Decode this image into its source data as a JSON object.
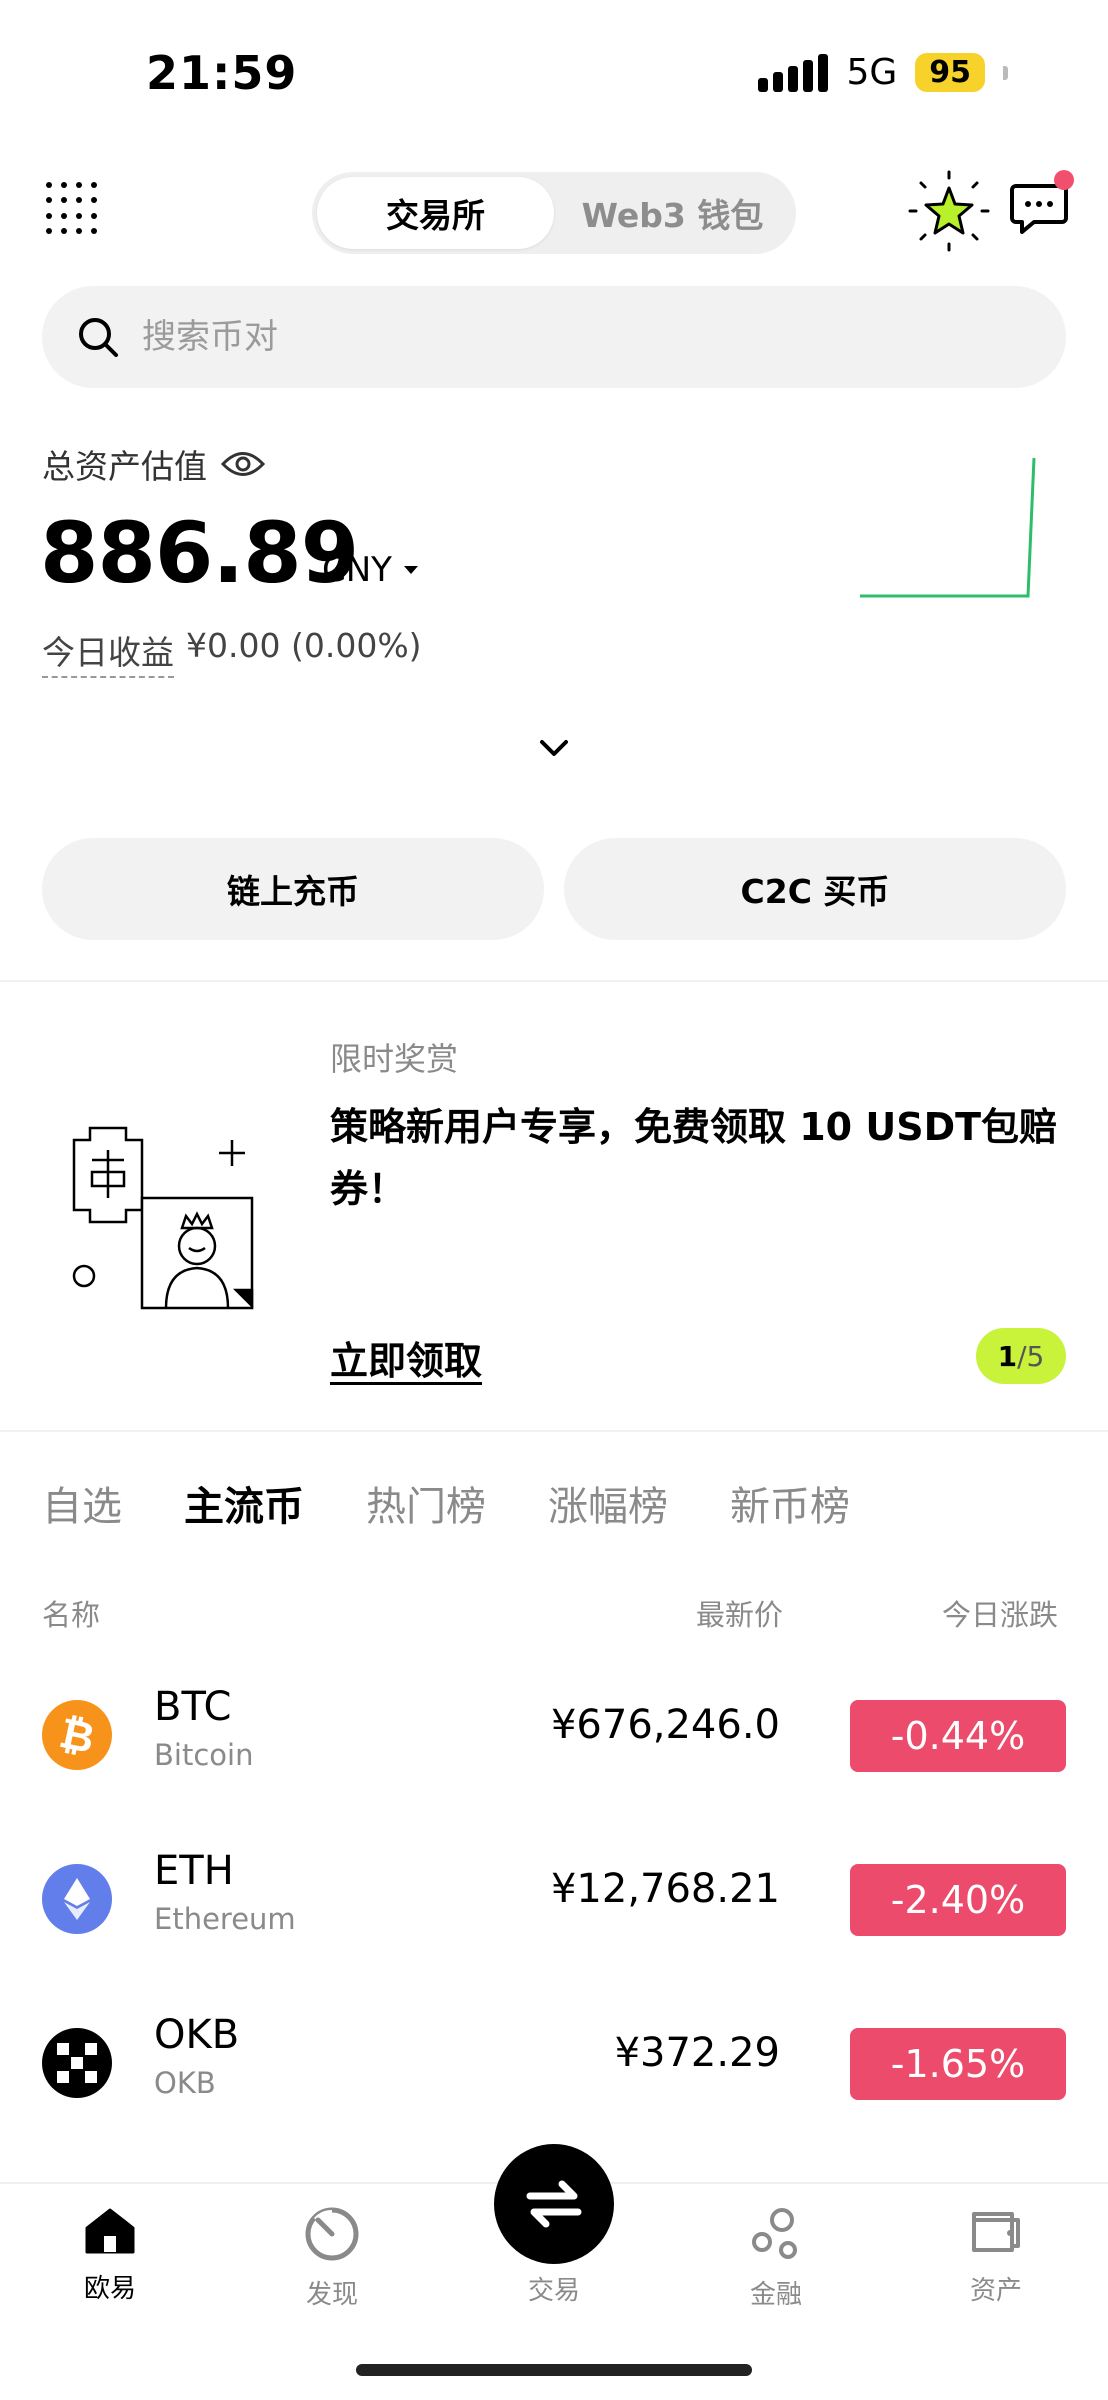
{
  "status_bar": {
    "time": "21:59",
    "network": "5G",
    "battery": "95"
  },
  "header": {
    "tabs": [
      {
        "label": "交易所",
        "active": true
      },
      {
        "label": "Web3 钱包",
        "active": false
      }
    ]
  },
  "search": {
    "placeholder": "搜索币对"
  },
  "assets": {
    "label": "总资产估值",
    "value": "886.89",
    "currency": "CNY",
    "pnl_label": "今日收益",
    "pnl_value": "¥0.00 (0.00%)"
  },
  "actions": {
    "onchain_deposit": "链上充币",
    "c2c_buy": "C2C 买币"
  },
  "promo": {
    "tag": "限时奖赏",
    "title": "策略新用户专享，免费领取 10 USDT包赔券！",
    "cta": "立即领取",
    "page_current": "1",
    "page_total": "/5"
  },
  "market_tabs": [
    {
      "label": "自选",
      "active": false
    },
    {
      "label": "主流币",
      "active": true
    },
    {
      "label": "热门榜",
      "active": false
    },
    {
      "label": "涨幅榜",
      "active": false
    },
    {
      "label": "新币榜",
      "active": false
    }
  ],
  "columns": {
    "name": "名称",
    "price": "最新价",
    "change": "今日涨跌"
  },
  "coins": [
    {
      "symbol": "BTC",
      "name": "Bitcoin",
      "price": "¥676,246.0",
      "change": "-0.44%",
      "icon": "bitcoin-icon",
      "color": "#f7931a"
    },
    {
      "symbol": "ETH",
      "name": "Ethereum",
      "price": "¥12,768.21",
      "change": "-2.40%",
      "icon": "ethereum-icon",
      "color": "#627eea"
    },
    {
      "symbol": "OKB",
      "name": "OKB",
      "price": "¥372.29",
      "change": "-1.65%",
      "icon": "okb-icon",
      "color": "#000000"
    }
  ],
  "colors": {
    "down": "#ec4b6c",
    "accent_green": "#c9f23a",
    "sparkline": "#2ebd6b"
  },
  "bottom_nav": [
    {
      "label": "欧易",
      "active": true
    },
    {
      "label": "发现",
      "active": false
    },
    {
      "label": "交易",
      "active": false
    },
    {
      "label": "金融",
      "active": false
    },
    {
      "label": "资产",
      "active": false
    }
  ]
}
